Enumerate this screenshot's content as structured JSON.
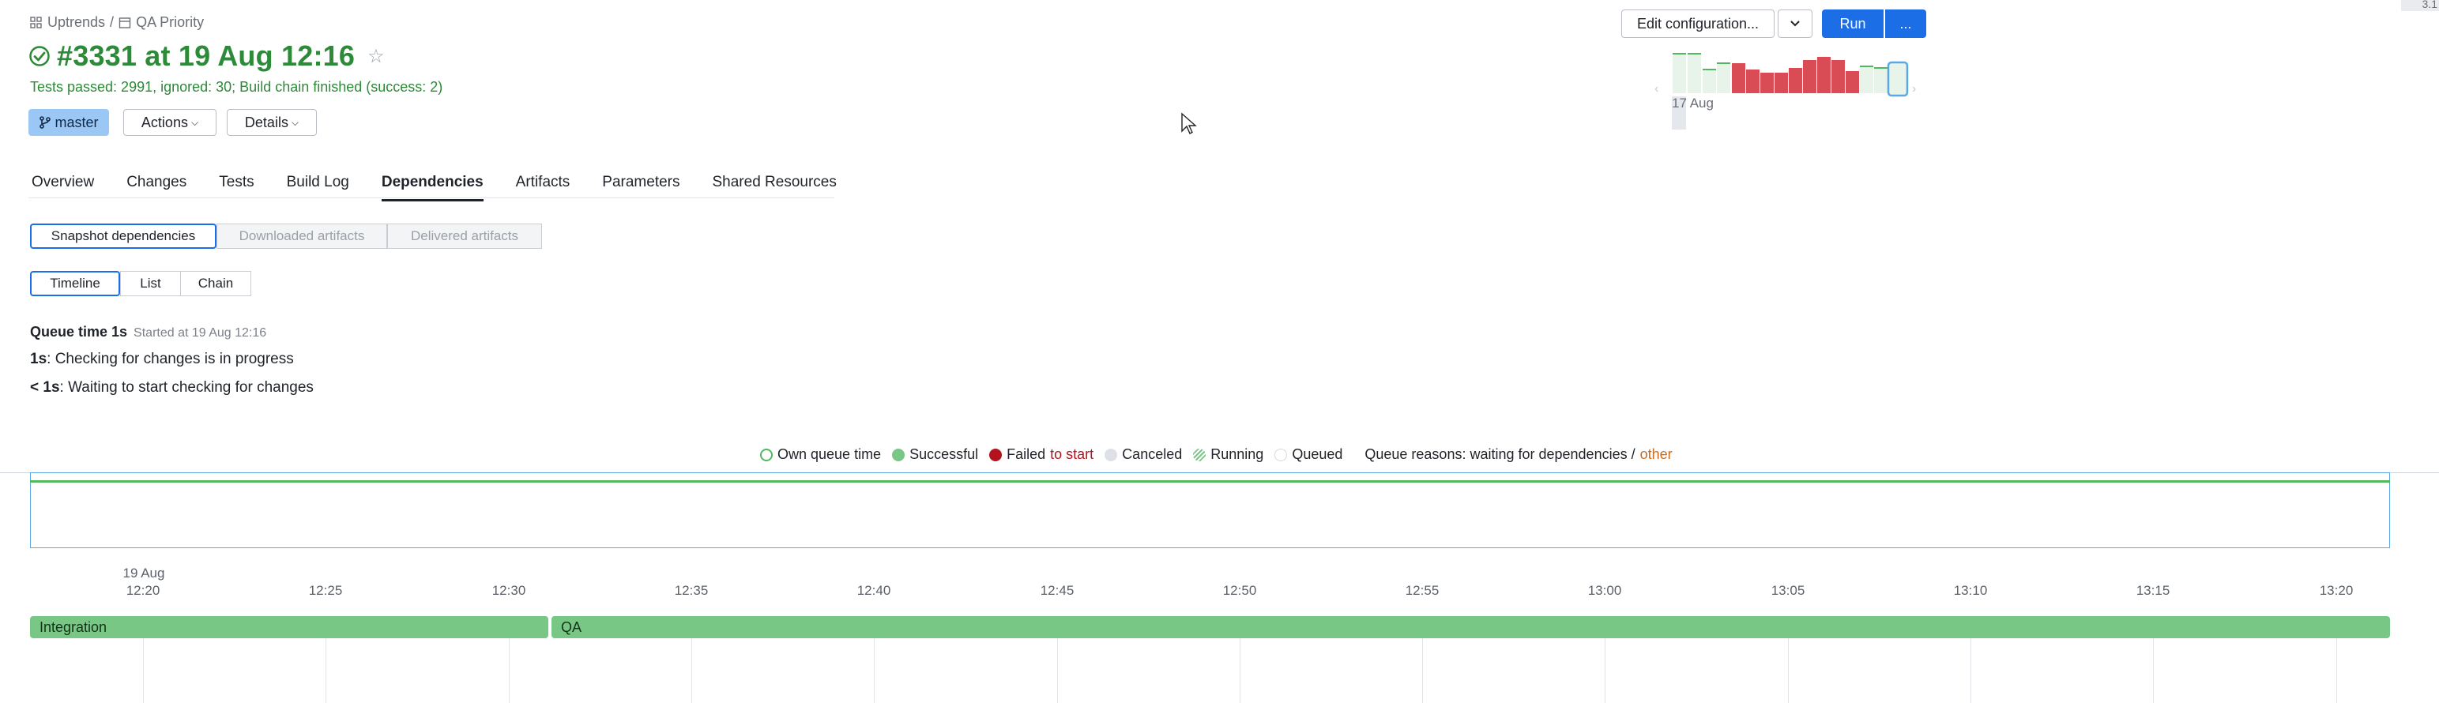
{
  "breadcrumb": {
    "project": "Uptrends",
    "separator": "/",
    "build_config": "QA Priority"
  },
  "build": {
    "title": "#3331 at 19 Aug 12:16",
    "summary": "Tests passed: 2991, ignored: 30; Build chain finished (success: 2)",
    "branch": "master"
  },
  "toolbar": {
    "actions_label": "Actions",
    "details_label": "Details",
    "edit_config_label": "Edit configuration...",
    "run_label": "Run",
    "more_label": "..."
  },
  "mini_chart": {
    "date_label": "17 Aug",
    "bar_colors": {
      "success": "#e8f3ea",
      "failed": "#d94b55",
      "selected": "#5aa9e6"
    }
  },
  "tabs": [
    {
      "label": "Overview",
      "active": false
    },
    {
      "label": "Changes",
      "active": false
    },
    {
      "label": "Tests",
      "active": false
    },
    {
      "label": "Build Log",
      "active": false
    },
    {
      "label": "Dependencies",
      "active": true
    },
    {
      "label": "Artifacts",
      "active": false
    },
    {
      "label": "Parameters",
      "active": false
    },
    {
      "label": "Shared Resources",
      "active": false
    }
  ],
  "dep_filter": {
    "snapshot": "Snapshot dependencies",
    "downloaded": "Downloaded artifacts",
    "delivered": "Delivered artifacts"
  },
  "view_mode": {
    "timeline": "Timeline",
    "list": "List",
    "chain": "Chain"
  },
  "queue": {
    "title": "Queue time 1s",
    "started": "Started at 19 Aug 12:16",
    "line1_bold": "1s",
    "line1_text": ": Checking for changes is in progress",
    "line2_bold": "< 1s",
    "line2_text": ": Waiting to start checking for changes"
  },
  "legend": {
    "own_queue": "Own queue time",
    "successful": "Successful",
    "failed": "Failed",
    "to_start": "to start",
    "canceled": "Canceled",
    "running": "Running",
    "queued": "Queued",
    "reasons_prefix": "Queue reasons: waiting for dependencies /",
    "reasons_other": "other"
  },
  "timeline": {
    "date_label": "19 Aug",
    "ticks": [
      "12:20",
      "12:25",
      "12:30",
      "12:35",
      "12:40",
      "12:45",
      "12:50",
      "12:55",
      "13:00",
      "13:05",
      "13:10",
      "13:15",
      "13:20"
    ],
    "builds": [
      {
        "name": "Integration"
      },
      {
        "name": "QA"
      }
    ]
  },
  "colors": {
    "success_text": "#2c8a38",
    "accent": "#1b6ee6",
    "bar_green": "#79c784",
    "failed": "#b3131f",
    "other_link": "#c86b1e"
  },
  "corner_text": "3.1"
}
